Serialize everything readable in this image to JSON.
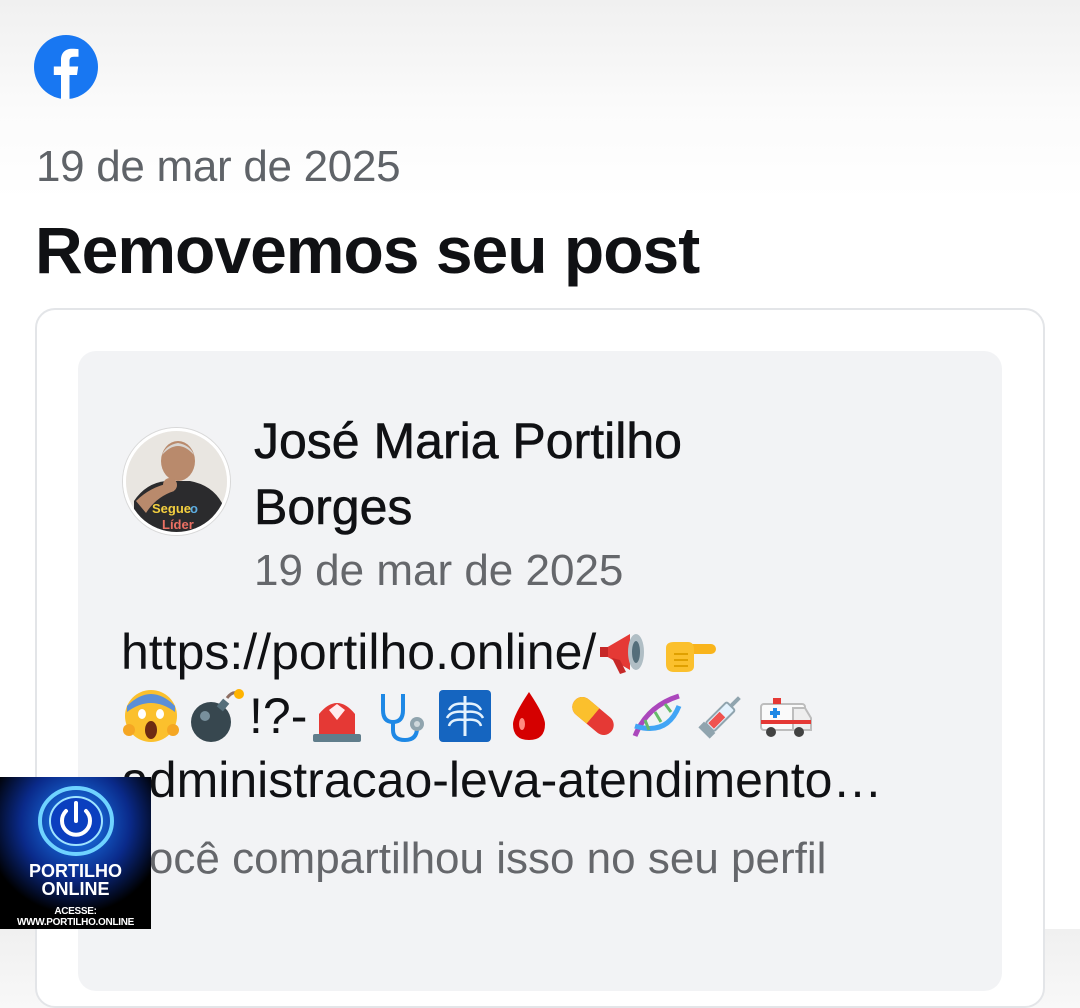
{
  "header": {
    "logo_icon": "facebook-logo-icon",
    "brand_color": "#1877f2",
    "date": "19 de mar de 2025",
    "title": "Removemos seu post"
  },
  "post": {
    "author_line1": "José Maria Portilho",
    "author_line2": "Borges",
    "date": "19 de mar de 2025",
    "link_line1": "https://portilho.online/",
    "link_line1_emojis": [
      "megaphone-icon",
      "pointing-hand-icon"
    ],
    "link_line2_prefix_emojis": [
      "screaming-face-icon",
      "bomb-icon"
    ],
    "link_line2_text": "!?-",
    "link_line2_emojis": [
      "rotating-light-icon",
      "stethoscope-icon",
      "x-ray-icon",
      "drop-of-blood-icon",
      "pill-icon",
      "dna-icon",
      "syringe-icon",
      "ambulance-icon"
    ],
    "link_line3": "administracao-leva-atendimento…",
    "shared_note": "Você compartilhou isso no seu perfil",
    "avatar_caption": "Segue o Líder"
  },
  "watermark": {
    "icon": "power-button-icon",
    "title": "PORTILHO",
    "subtitle": "ONLINE",
    "url": "ACESSE: WWW.PORTILHO.ONLINE"
  }
}
